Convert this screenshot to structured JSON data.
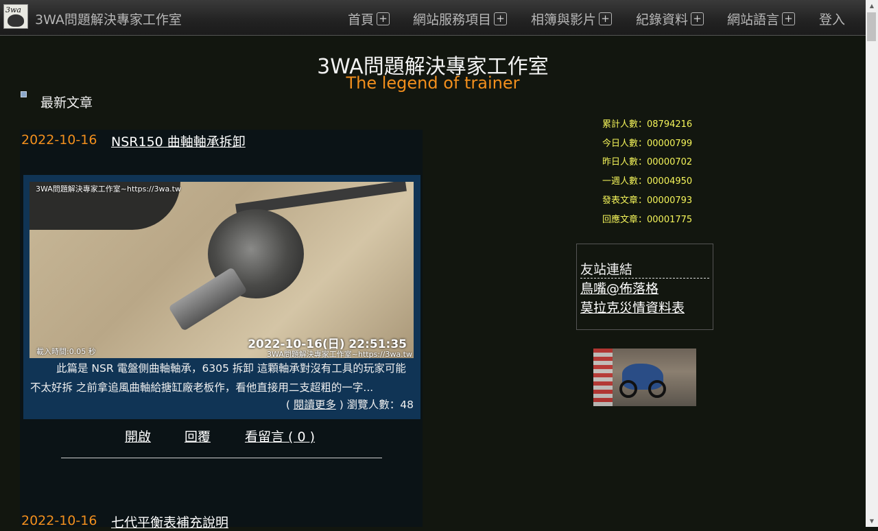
{
  "nav": {
    "brand": "3WA問題解決專家工作室",
    "items": [
      {
        "label": "首頁",
        "plus": "+"
      },
      {
        "label": "網站服務項目",
        "plus": "+"
      },
      {
        "label": "相簿與影片",
        "plus": "+"
      },
      {
        "label": "紀錄資料",
        "plus": "+"
      },
      {
        "label": "網站語言",
        "plus": "+"
      },
      {
        "label": "登入"
      }
    ],
    "logo_text": "3wa"
  },
  "header": {
    "title": "3WA問題解決專家工作室",
    "subtitle": "The legend of trainer"
  },
  "section": {
    "title": "最新文章"
  },
  "articles": [
    {
      "date": "2022-10-16",
      "title": "NSR150 曲軸軸承拆卸",
      "photo": {
        "watermark": "3WA問題解決專家工作室~https://3wa.tw",
        "stamp": "2022-10-16(日) 22:51:35",
        "load": "載入時間:0.05 秒",
        "watermark2": "3WA問題解決專家工作室~https://3wa.tw"
      },
      "excerpt": "此篇是 NSR 電盤側曲軸軸承，6305 拆卸 這顆軸承對沒有工具的玩家可能不太好拆 之前拿追風曲軸給搪缸廠老板作，看他直接用二支超粗的一字...",
      "read_more_prefix": "( ",
      "read_more": "閱讀更多",
      "read_more_suffix": " )",
      "views_label": "瀏覽人數：48",
      "actions": {
        "open": "開啟",
        "reply": "回覆",
        "comments": "看留言 ( 0 )"
      }
    },
    {
      "date": "2022-10-16",
      "title": "七代平衡表補充說明"
    }
  ],
  "stats": [
    "累計人數：08794216",
    "今日人數：00000799",
    "昨日人數：00000702",
    "一週人數：00004950",
    "發表文章：00000793",
    "回應文章：00001775"
  ],
  "friends": {
    "title": "友站連結",
    "links": [
      "鳥嘴@佈落格",
      "莫拉克災情資料表"
    ]
  },
  "colors": {
    "background": "#12160f",
    "accent_orange": "#f28f1d",
    "stats_yellow": "#f5f55a",
    "card_blue": "#103455"
  },
  "scrollbar": {
    "up": "▲",
    "down": "▼"
  }
}
